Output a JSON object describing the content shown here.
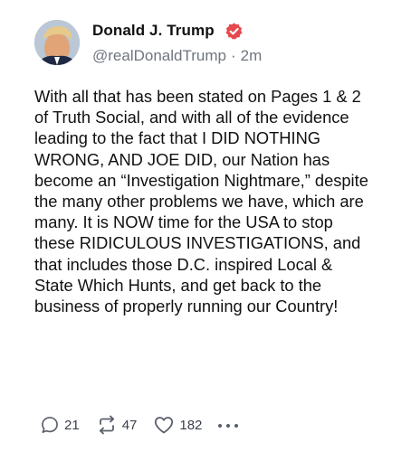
{
  "author": {
    "display_name": "Donald J. Trump",
    "handle": "@realDonaldTrump",
    "separator": "·",
    "timestamp": "2m",
    "verified_icon": "verified-badge-icon",
    "verified_color": "#e5484d"
  },
  "post": {
    "text": "With all that has been stated on Pages 1 & 2 of Truth Social, and with all of the evidence leading to the fact that I DID NOTHING WRONG, AND JOE DID, our Nation has become an “Investigation Nightmare,” despite the many other problems we have, which are many. It is NOW time for the USA to stop these RIDICULOUS INVESTIGATIONS, and that includes those D.C. inspired Local & State Which Hunts, and get back to the business of properly running our Country!"
  },
  "actions": {
    "replies": "21",
    "reposts": "47",
    "likes": "182",
    "reply_icon": "reply-icon",
    "repost_icon": "repost-icon",
    "like_icon": "heart-icon",
    "more_icon": "more-dots-icon",
    "icon_color": "#5a5f6a"
  }
}
